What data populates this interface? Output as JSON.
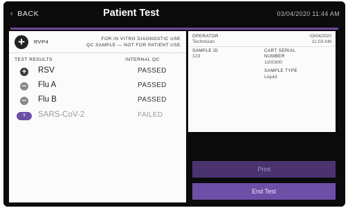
{
  "header": {
    "back_label": "BACK",
    "back_glyph": "‹",
    "title": "Patient Test",
    "datetime": "03/04/2020 11:44 AM"
  },
  "panel": {
    "name": "RVP4",
    "notice_line1": "FOR IN VITRO DIAGNOSTIC USE",
    "notice_line2": "QC SAMPLE — NOT FOR PATIENT USE",
    "col_test_results": "TEST RESULTS",
    "col_internal_qc": "INTERNAL QC"
  },
  "results": [
    {
      "name": "RSV",
      "status": "positive",
      "icon": "plus-icon",
      "glyph": "+",
      "qc": "PASSED"
    },
    {
      "name": "Flu A",
      "status": "negative",
      "icon": "minus-icon",
      "glyph": "−",
      "qc": "PASSED"
    },
    {
      "name": "Flu B",
      "status": "negative",
      "icon": "minus-icon",
      "glyph": "−",
      "qc": "PASSED"
    },
    {
      "name": "SARS-CoV-2",
      "status": "failed",
      "icon": "failed-badge-icon",
      "glyph": "?",
      "qc": "FAILED"
    }
  ],
  "info": {
    "operator_label": "OPERATOR",
    "operator_value": "Technician",
    "date_value": "03/04/2020",
    "time_value": "11:03 AM",
    "sample_id_label": "SAMPLE ID",
    "sample_id_value": "123",
    "cart_serial_label": "CART SERIAL NUMBER",
    "cart_serial_value": "1100300",
    "sample_type_label": "SAMPLE TYPE",
    "sample_type_value": "Liquid"
  },
  "buttons": {
    "print": "Print",
    "end_test": "End Test"
  },
  "colors": {
    "accent": "#6f4a9c",
    "end_test_button": "#6e4ea6",
    "print_button_disabled": "#4b3370"
  }
}
